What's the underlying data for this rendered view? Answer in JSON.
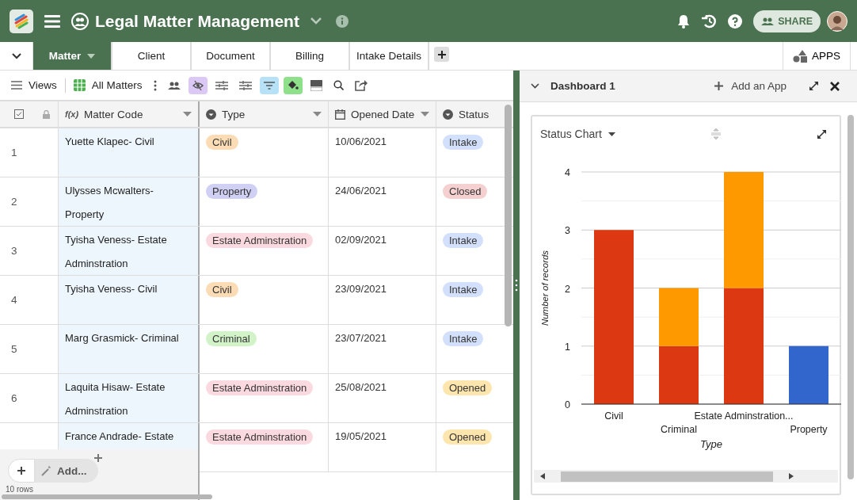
{
  "app": {
    "title": "Legal Matter Management",
    "share_label": "SHARE"
  },
  "tabs": [
    {
      "label": "Matter",
      "selected": true
    },
    {
      "label": "Client",
      "selected": false
    },
    {
      "label": "Document",
      "selected": false
    },
    {
      "label": "Billing",
      "selected": false
    },
    {
      "label": "Intake Details",
      "selected": false
    }
  ],
  "apps_label": "APPS",
  "toolbar": {
    "views_label": "Views",
    "view_name": "All Matters",
    "hide_fields_on": true,
    "filter_on": true,
    "color_on": true
  },
  "table": {
    "formula_icon": "f(x)",
    "columns": [
      "Matter Code",
      "Type",
      "Opened Date",
      "Status"
    ],
    "rows": [
      {
        "number": "1",
        "matter_code": "Yuette Klapec- Civil",
        "type": {
          "label": "Civil",
          "color": "#fbdcb5"
        },
        "opened": "10/06/2021",
        "status": {
          "label": "Intake",
          "color": "#d3e0fb"
        }
      },
      {
        "number": "2",
        "matter_code": "Ulysses Mcwalters- Property",
        "type": {
          "label": "Property",
          "color": "#cfd0f3"
        },
        "opened": "24/06/2021",
        "status": {
          "label": "Closed",
          "color": "#f5d0d0"
        }
      },
      {
        "number": "3",
        "matter_code": "Tyisha Veness- Estate Adminstration",
        "type": {
          "label": "Estate Adminstration",
          "color": "#fbd9e0"
        },
        "opened": "02/09/2021",
        "status": {
          "label": "Intake",
          "color": "#d3e0fb"
        }
      },
      {
        "number": "4",
        "matter_code": "Tyisha Veness- Civil",
        "type": {
          "label": "Civil",
          "color": "#fbdcb5"
        },
        "opened": "23/09/2021",
        "status": {
          "label": "Intake",
          "color": "#d3e0fb"
        }
      },
      {
        "number": "5",
        "matter_code": "Marg Grasmick- Criminal",
        "type": {
          "label": "Criminal",
          "color": "#d2f3c8"
        },
        "opened": "23/07/2021",
        "status": {
          "label": "Intake",
          "color": "#d3e0fb"
        }
      },
      {
        "number": "6",
        "matter_code": "Laquita Hisaw- Estate Adminstration",
        "type": {
          "label": "Estate Adminstration",
          "color": "#fbd9e0"
        },
        "opened": "25/08/2021",
        "status": {
          "label": "Opened",
          "color": "#fde5ae"
        }
      },
      {
        "matter_code": "France Andrade- Estate",
        "type": {
          "label": "Estate Adminstration",
          "color": "#fbd9e0"
        },
        "opened": "19/05/2021",
        "status": {
          "label": "Opened",
          "color": "#fde5ae"
        }
      }
    ],
    "add_label": "Add...",
    "row_count": "10 rows"
  },
  "dashboard": {
    "title": "Dashboard 1",
    "add_app_label": "Add an App"
  },
  "widget": {
    "title": "Status Chart",
    "chart_data": {
      "type": "bar",
      "stacked": true,
      "grid": true,
      "xlabel": "Type",
      "ylabel": "Number of records",
      "categories": [
        "Civil",
        "Criminal",
        "Estate Adminstration...",
        "Property"
      ],
      "series": [
        {
          "color": "#dc3912",
          "values": [
            3,
            1,
            2,
            0
          ]
        },
        {
          "color": "#ff9900",
          "values": [
            0,
            1,
            2,
            0
          ]
        },
        {
          "color": "#3366cc",
          "values": [
            0,
            0,
            0,
            1
          ]
        }
      ],
      "ylim": [
        0,
        4
      ],
      "yticks": [
        0,
        1,
        2,
        3,
        4
      ]
    }
  }
}
